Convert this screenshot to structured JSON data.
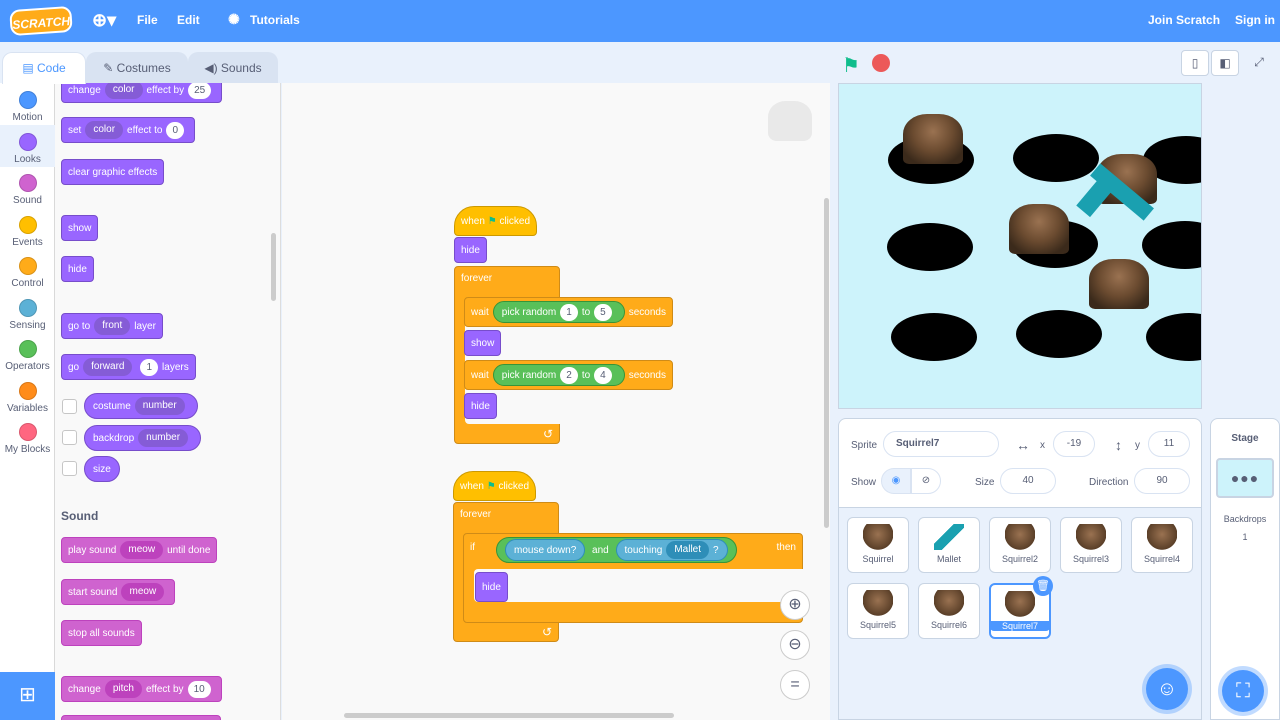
{
  "menubar": {
    "logo": "SCRATCH",
    "file": "File",
    "edit": "Edit",
    "tutorials": "Tutorials",
    "join": "Join Scratch",
    "signin": "Sign in"
  },
  "tabs": {
    "code": "Code",
    "costumes": "Costumes",
    "sounds": "Sounds"
  },
  "categories": [
    {
      "label": "Motion",
      "color": "#4c97ff"
    },
    {
      "label": "Looks",
      "color": "#9966ff"
    },
    {
      "label": "Sound",
      "color": "#cf63cf"
    },
    {
      "label": "Events",
      "color": "#ffbf00"
    },
    {
      "label": "Control",
      "color": "#ffab19"
    },
    {
      "label": "Sensing",
      "color": "#5cb1d6"
    },
    {
      "label": "Operators",
      "color": "#59c059"
    },
    {
      "label": "Variables",
      "color": "#ff8c1a"
    },
    {
      "label": "My Blocks",
      "color": "#ff6680"
    }
  ],
  "palette": {
    "change_effect": {
      "a": "change",
      "dd": "color",
      "b": "effect by",
      "v": "25"
    },
    "set_effect": {
      "a": "set",
      "dd": "color",
      "b": "effect to",
      "v": "0"
    },
    "clear_effects": "clear graphic effects",
    "show": "show",
    "hide": "hide",
    "goto_layer": {
      "a": "go to",
      "dd": "front",
      "b": "layer"
    },
    "go_layers": {
      "a": "go",
      "dd": "forward",
      "v": "1",
      "b": "layers"
    },
    "costume": {
      "a": "costume",
      "dd": "number"
    },
    "backdrop": {
      "a": "backdrop",
      "dd": "number"
    },
    "size": "size",
    "sound_heading": "Sound",
    "play_sound": {
      "a": "play sound",
      "dd": "meow",
      "b": "until done"
    },
    "start_sound": {
      "a": "start sound",
      "dd": "meow"
    },
    "stop_sounds": "stop all sounds",
    "change_pitch": {
      "a": "change",
      "dd": "pitch",
      "b": "effect by",
      "v": "10"
    }
  },
  "script1": {
    "hat": {
      "a": "when",
      "b": "clicked"
    },
    "hide1": "hide",
    "forever": "forever",
    "wait1": {
      "a": "wait",
      "op": "pick random",
      "from": "1",
      "to_label": "to",
      "to": "5",
      "b": "seconds"
    },
    "show": "show",
    "wait2": {
      "a": "wait",
      "op": "pick random",
      "from": "2",
      "to_label": "to",
      "to": "4",
      "b": "seconds"
    },
    "hide2": "hide"
  },
  "script2": {
    "hat": {
      "a": "when",
      "b": "clicked"
    },
    "forever": "forever",
    "if": "if",
    "mouse_down": "mouse down?",
    "and": "and",
    "touching": "touching",
    "touching_dd": "Mallet",
    "q": "?",
    "then": "then",
    "hide": "hide"
  },
  "sprite_info": {
    "sprite_label": "Sprite",
    "sprite_name": "Squirrel7",
    "x_label": "x",
    "x": "-19",
    "y_label": "y",
    "y": "11",
    "show_label": "Show",
    "size_label": "Size",
    "size": "40",
    "direction_label": "Direction",
    "direction": "90"
  },
  "sprites": [
    "Squirrel",
    "Mallet",
    "Squirrel2",
    "Squirrel3",
    "Squirrel4",
    "Squirrel5",
    "Squirrel6",
    "Squirrel7"
  ],
  "stage_panel": {
    "title": "Stage",
    "backdrops_label": "Backdrops",
    "backdrops_count": "1"
  },
  "colors": {
    "accent": "#4c97ff",
    "looks": "#9966ff",
    "control": "#ffab19",
    "events": "#ffbf00",
    "operators": "#59c059",
    "sensing": "#5cb1d6",
    "sound": "#cf63cf"
  }
}
